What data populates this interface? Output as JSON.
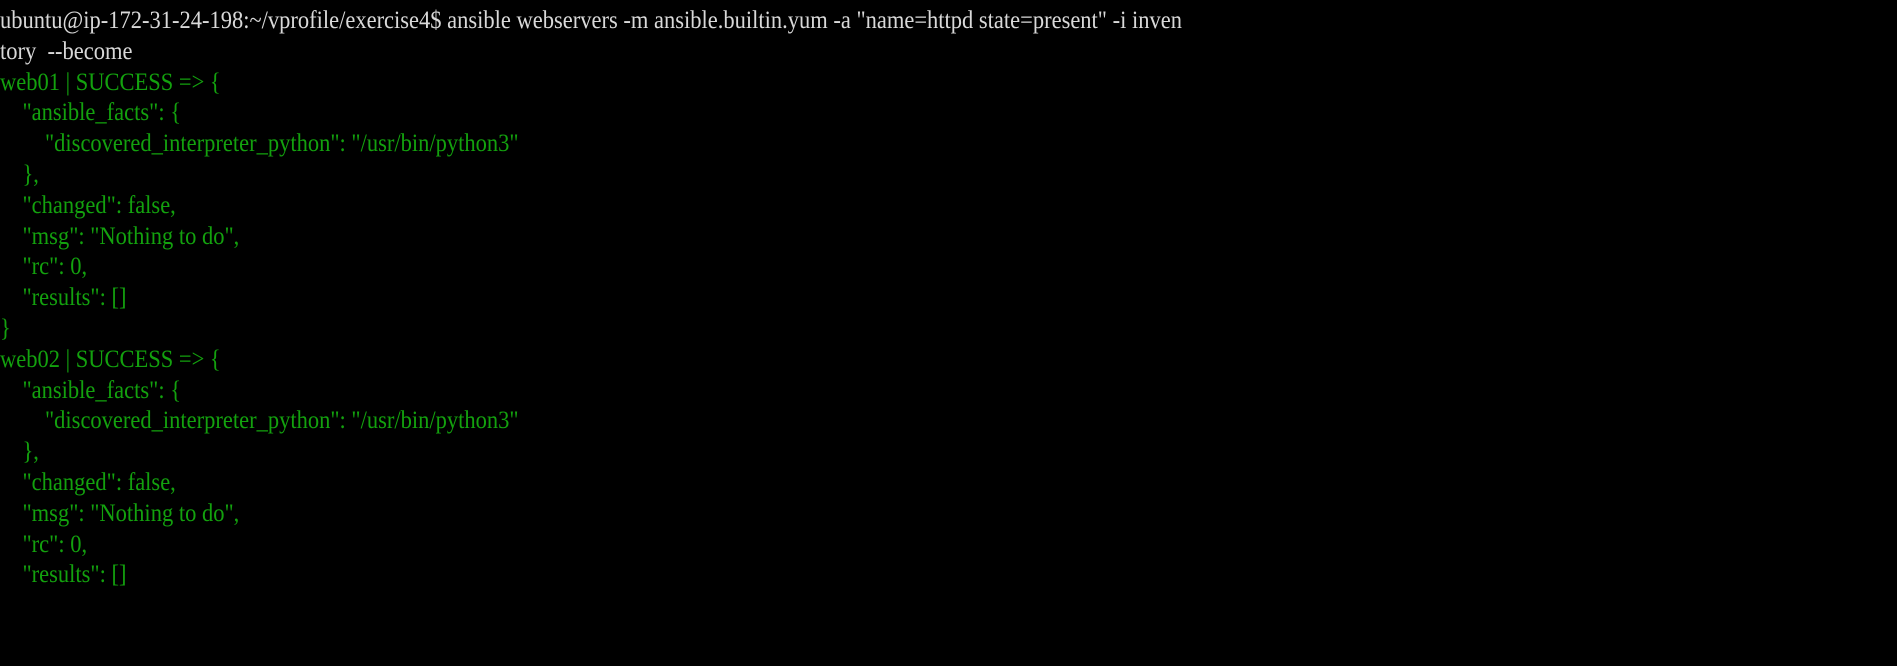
{
  "terminal": {
    "lines": [
      {
        "text": "ubuntu@ip-172-31-24-198:~/vprofile/exercise4$ ansible webservers -m ansible.builtin.yum -a \"name=httpd state=present\" -i inven",
        "color": "white"
      },
      {
        "text": "tory  --become",
        "color": "white"
      },
      {
        "text": "web01 | SUCCESS => {",
        "color": "green"
      },
      {
        "text": "    \"ansible_facts\": {",
        "color": "green"
      },
      {
        "text": "        \"discovered_interpreter_python\": \"/usr/bin/python3\"",
        "color": "green"
      },
      {
        "text": "    },",
        "color": "green"
      },
      {
        "text": "    \"changed\": false,",
        "color": "green"
      },
      {
        "text": "    \"msg\": \"Nothing to do\",",
        "color": "green"
      },
      {
        "text": "    \"rc\": 0,",
        "color": "green"
      },
      {
        "text": "    \"results\": []",
        "color": "green"
      },
      {
        "text": "}",
        "color": "green"
      },
      {
        "text": "web02 | SUCCESS => {",
        "color": "green"
      },
      {
        "text": "    \"ansible_facts\": {",
        "color": "green"
      },
      {
        "text": "        \"discovered_interpreter_python\": \"/usr/bin/python3\"",
        "color": "green"
      },
      {
        "text": "    },",
        "color": "green"
      },
      {
        "text": "    \"changed\": false,",
        "color": "green"
      },
      {
        "text": "    \"msg\": \"Nothing to do\",",
        "color": "green"
      },
      {
        "text": "    \"rc\": 0,",
        "color": "green"
      },
      {
        "text": "    \"results\": []",
        "color": "green"
      }
    ]
  },
  "colors": {
    "background": "#000000",
    "white": "#d9d9d9",
    "green": "#13a10e"
  }
}
